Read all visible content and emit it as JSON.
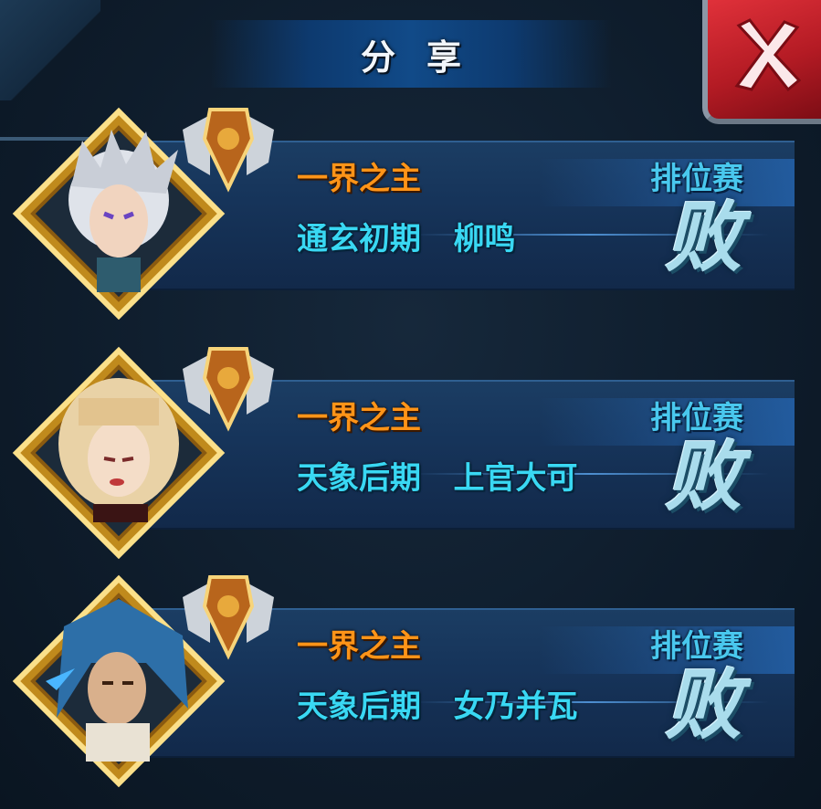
{
  "header": {
    "title": "分享"
  },
  "close_button": {
    "icon": "close-icon",
    "color": "#c8242c"
  },
  "colors": {
    "title_orange": "#ff9418",
    "info_cyan": "#39d8f3",
    "mode_blue": "#49c8ee",
    "result": "#a9dcec"
  },
  "entries": [
    {
      "title": "一界之主",
      "realm": "通玄初期",
      "name": "柳鸣",
      "mode": "排位赛",
      "result": "败",
      "avatar": "white-haired-hero-portrait"
    },
    {
      "title": "一界之主",
      "realm": "天象后期",
      "name": "上官大可",
      "mode": "排位赛",
      "result": "败",
      "avatar": "blonde-heroine-portrait"
    },
    {
      "title": "一界之主",
      "realm": "天象后期",
      "name": "女乃并瓦",
      "mode": "排位赛",
      "result": "败",
      "avatar": "blue-haired-warrior-portrait"
    }
  ]
}
